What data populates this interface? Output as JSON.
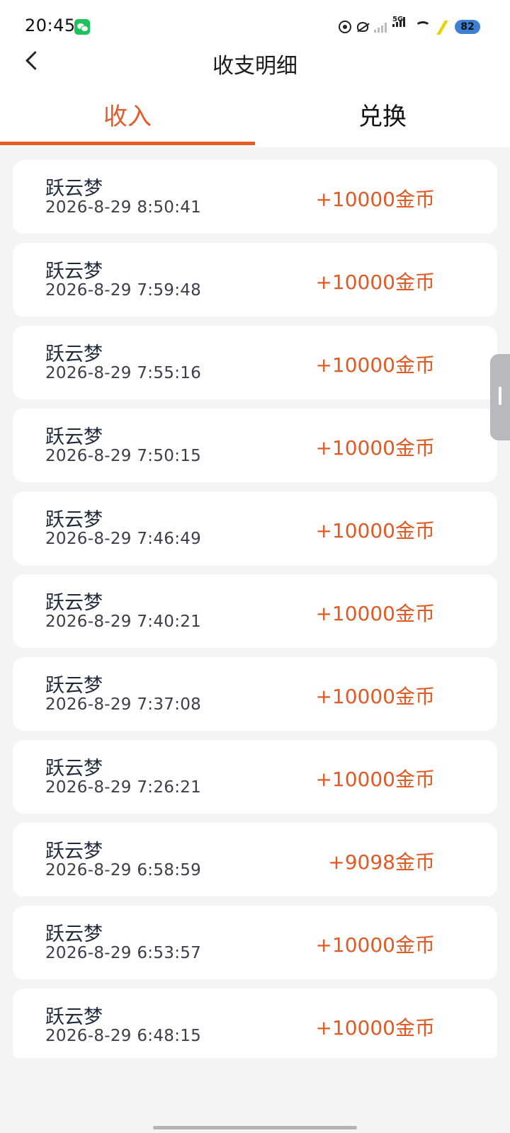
{
  "status_bar": {
    "time": "20:45",
    "network_label": "5G",
    "battery": "82",
    "icons": [
      "wechat-icon",
      "eye-comfort-icon",
      "silent-icon",
      "signal-icon",
      "signal-5g-icon",
      "wifi-icon",
      "charging-icon",
      "battery-icon"
    ]
  },
  "header": {
    "title": "收支明细",
    "back_icon": "chevron-left-icon"
  },
  "tabs": [
    {
      "label": "收入",
      "active": true
    },
    {
      "label": "兑换",
      "active": false
    }
  ],
  "colors": {
    "accent": "#e65a26",
    "amount": "#e05a24",
    "background": "#f4f4f4",
    "card": "#ffffff"
  },
  "records": [
    {
      "name": "跃云梦",
      "time": "2026-8-29 8:50:41",
      "amount": "+10000金币"
    },
    {
      "name": "跃云梦",
      "time": "2026-8-29 7:59:48",
      "amount": "+10000金币"
    },
    {
      "name": "跃云梦",
      "time": "2026-8-29 7:55:16",
      "amount": "+10000金币"
    },
    {
      "name": "跃云梦",
      "time": "2026-8-29 7:50:15",
      "amount": "+10000金币"
    },
    {
      "name": "跃云梦",
      "time": "2026-8-29 7:46:49",
      "amount": "+10000金币"
    },
    {
      "name": "跃云梦",
      "time": "2026-8-29 7:40:21",
      "amount": "+10000金币"
    },
    {
      "name": "跃云梦",
      "time": "2026-8-29 7:37:08",
      "amount": "+10000金币"
    },
    {
      "name": "跃云梦",
      "time": "2026-8-29 7:26:21",
      "amount": "+10000金币"
    },
    {
      "name": "跃云梦",
      "time": "2026-8-29 6:58:59",
      "amount": "+9098金币"
    },
    {
      "name": "跃云梦",
      "time": "2026-8-29 6:53:57",
      "amount": "+10000金币"
    },
    {
      "name": "跃云梦",
      "time": "2026-8-29 6:48:15",
      "amount": "+10000金币"
    }
  ]
}
